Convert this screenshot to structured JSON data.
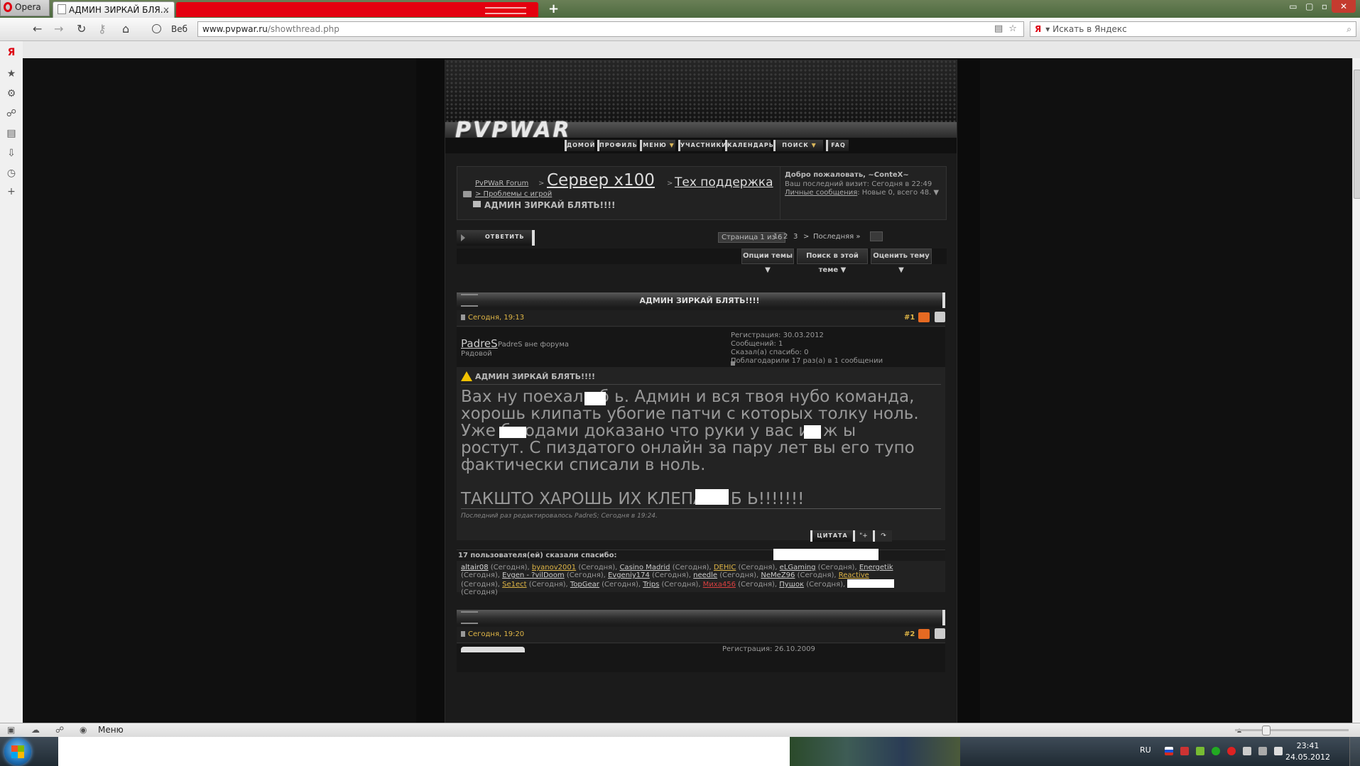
{
  "browser": {
    "menu_button": "Opera",
    "tab_title": "АДМИН ЗИРКАЙ БЛЯ...",
    "tab_close": "×",
    "new_tab": "+",
    "web_label": "Веб",
    "address_host": "www.pvpwar.ru",
    "address_path": "/showthread.php",
    "search_placeholder": "Искать в Яндекс",
    "search_engine_mark": "Я",
    "status_menu": "Меню"
  },
  "taskbar": {
    "lang": "RU",
    "time": "23:41",
    "date": "24.05.2012"
  },
  "site": {
    "logo": "PVPWAR",
    "nav": [
      {
        "label": "ДОМОЙ",
        "arrow": ""
      },
      {
        "label": "ПРОФИЛЬ",
        "arrow": ""
      },
      {
        "label": "МЕНЮ",
        "arrow": "▼"
      },
      {
        "label": "УЧАСТНИКИ",
        "arrow": ""
      },
      {
        "label": "КАЛЕНДАРЬ",
        "arrow": ""
      },
      {
        "label": "ПОИСК",
        "arrow": "▼"
      },
      {
        "label": "FAQ",
        "arrow": ""
      }
    ]
  },
  "breadcrumb": {
    "root": "PvPWaR Forum",
    "sep": ">",
    "server": "Сервер x100",
    "support": "Тех поддержка",
    "sub": "> Проблемы с игрой",
    "current": "АДМИН ЗИРКАЙ БЛЯТЬ!!!!"
  },
  "welcome": {
    "title": "Добро пожаловать, ~ConteX~",
    "last_visit": "Ваш последний визит: Сегодня в 22:49",
    "pm_link": "Личные сообщения",
    "pm_rest": ": Новые 0, всего 48. ▼"
  },
  "controls": {
    "reply": "ОТВЕТИТЬ",
    "pager_label": "Страница 1 из 6",
    "pages": [
      "1",
      "2",
      "3"
    ],
    "next": ">",
    "last": "Последняя »",
    "thread_options": "Опции темы ▼",
    "search_thread": "Поиск в этой теме ▼",
    "rate_thread": "Оценить тему ▼"
  },
  "thread": {
    "title": "АДМИН ЗИРКАЙ БЛЯТЬ!!!!"
  },
  "post1": {
    "date": "Сегодня, 19:13",
    "number": "#1",
    "author": "PadreS",
    "status": "PadreS вне форума",
    "rank": "Рядовой",
    "reg": "Регистрация: 30.03.2012",
    "posts": "Сообщений: 1",
    "said_thanks": "Сказал(а) спасибо: 0",
    "thanked": "Поблагодарили 17 раз(а) в 1 сообщении",
    "title": "АДМИН ЗИРКАЙ БЛЯТЬ!!!!",
    "message": "Вах ну поехали б      ь. Админ и вся твоя нубо команда,\nхорошь клипать убогие патчи с которых толку ноль.\nУже б       годами доказано что руки у вас из ж     ы\nростут. С пиздатого онлайн за пару лет вы его тупо\nфактически списали в ноль.\n\nТАКШТО ХАРОШЬ ИХ КЛЕПАТЬ Б         Ь!!!!!!!",
    "edited": "Последний раз редактировалось PadreS; Сегодня в 19:24.",
    "quote": "ЦИТАТА",
    "multiquote": "\"+",
    "quickreply": "↷"
  },
  "thanks": {
    "header": "17 пользователя(ей) сказали спасибо:",
    "when": "(Сегодня)",
    "users": [
      "altair08",
      "byanov2001",
      "Casino Madrid",
      "DEHIC",
      "eLGaming",
      "Energetik",
      "Evgen - ?vilDoom",
      "Evgeniy174",
      "needle",
      "NeMeZ96",
      "Reactive",
      "Se1ect",
      "TopGear",
      "Trips",
      "Миха456",
      "Пушок"
    ]
  },
  "post2": {
    "date": "Сегодня, 19:20",
    "number": "#2",
    "reg": "Регистрация: 26.10.2009"
  },
  "colors": {
    "accent_gold": "#e0b646",
    "opera_red": "#e4000f",
    "forum_bg": "#1b1b1b"
  }
}
